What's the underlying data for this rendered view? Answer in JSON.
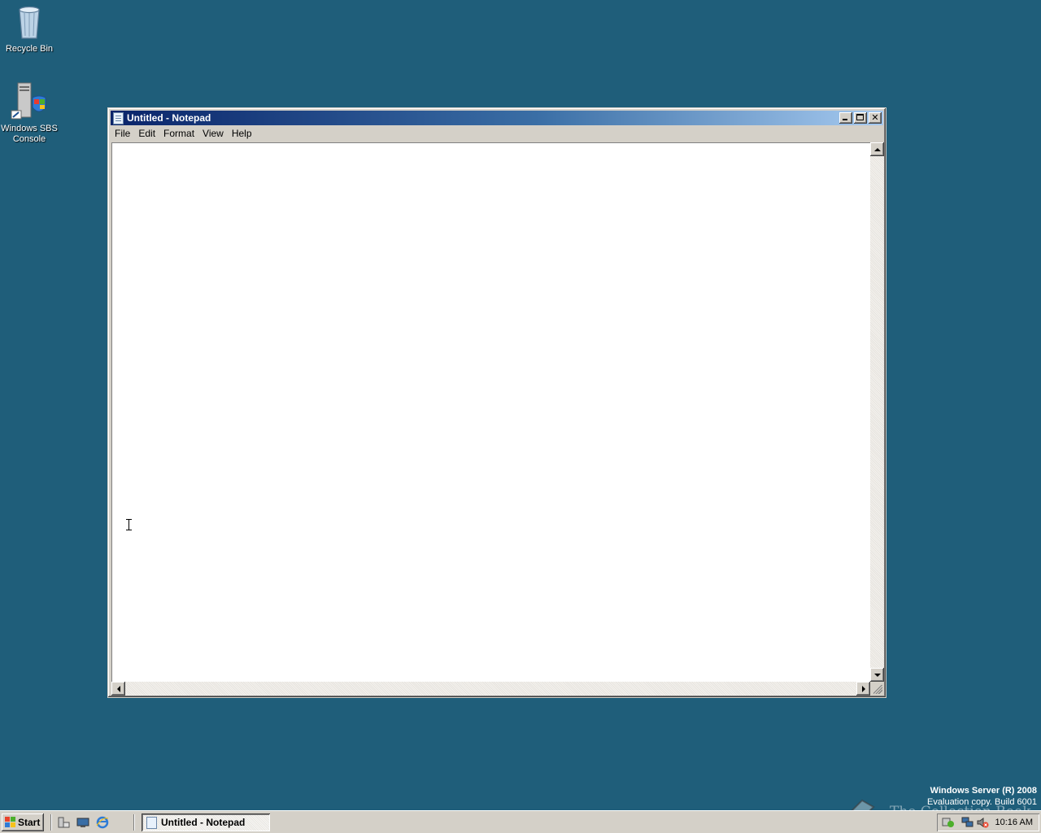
{
  "desktop": {
    "icons": [
      {
        "label": "Recycle Bin",
        "icon": "recycle-bin-icon"
      },
      {
        "label": "Windows SBS Console",
        "icon": "sbs-console-icon"
      }
    ],
    "background_color": "#1f5e7a"
  },
  "window": {
    "title": "Untitled - Notepad",
    "menu": [
      "File",
      "Edit",
      "Format",
      "View",
      "Help"
    ],
    "buttons": [
      "minimize",
      "maximize",
      "close"
    ],
    "content": ""
  },
  "watermark": {
    "line1": "Windows Server (R) 2008",
    "line2": "Evaluation copy. Build 6001",
    "overlay": "The Collection Book"
  },
  "taskbar": {
    "start_label": "Start",
    "quick_launch": [
      "server-manager-icon",
      "show-desktop-icon",
      "internet-explorer-icon"
    ],
    "tasks": [
      {
        "label": "Untitled - Notepad",
        "active": true
      }
    ],
    "clock": "10:16 AM"
  },
  "colors": {
    "title_active_start": "#0a246a",
    "title_active_end": "#a6caf0",
    "chrome": "#d4d0c8"
  }
}
